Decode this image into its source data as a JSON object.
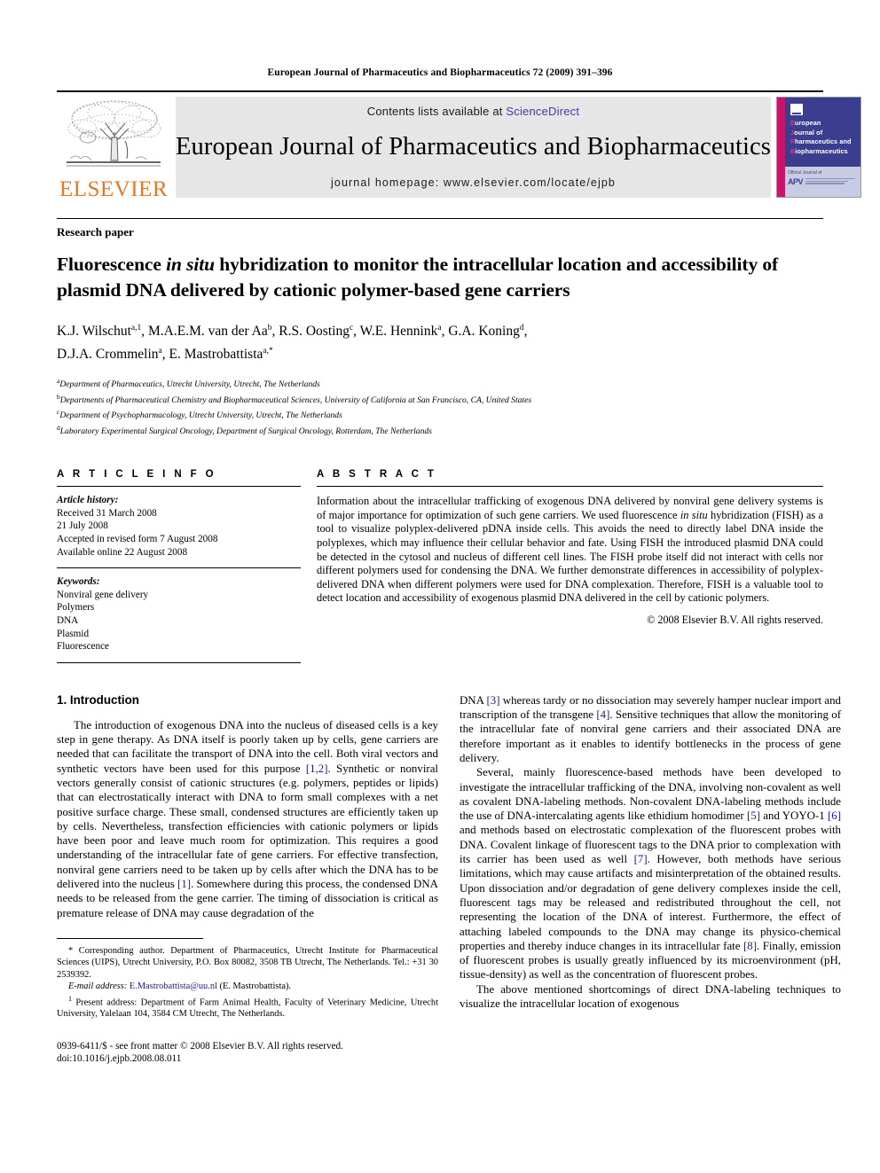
{
  "running_head": "European Journal of Pharmaceutics and Biopharmaceutics 72 (2009) 391–396",
  "masthead": {
    "publisher_name": "ELSEVIER",
    "contents_prefix": "Contents lists available at ",
    "sciencedirect": "ScienceDirect",
    "journal_title": "European Journal of Pharmaceutics and Biopharmaceutics",
    "homepage": "journal homepage: www.elsevier.com/locate/ejpb",
    "sciencedirect_color": "#3b3bb0",
    "elsevier_orange": "#e87722",
    "cover": {
      "line1_cap": "E",
      "line1_rest": "uropean",
      "line2_cap": "J",
      "line2_rest": "ournal of",
      "line3_cap": "P",
      "line3_rest": "harmaceutics and",
      "line4_cap": "B",
      "line4_rest": "iopharmaceutics",
      "footer_label": "Official Journal of",
      "apv": "APV",
      "band_color": "#3b3d8f",
      "spine_color": "#c7156b",
      "body_color": "#c8cbe4"
    }
  },
  "article_type": "Research paper",
  "title": {
    "part1": "Fluorescence ",
    "italic": "in situ",
    "part2": " hybridization to monitor the intracellular location and accessibility of plasmid DNA delivered by cationic polymer-based gene carriers"
  },
  "authors": [
    {
      "name": "K.J. Wilschut",
      "sup": "a,1",
      "sep": ", "
    },
    {
      "name": "M.A.E.M. van der Aa",
      "sup": "b",
      "sep": ", "
    },
    {
      "name": "R.S. Oosting",
      "sup": "c",
      "sep": ", "
    },
    {
      "name": "W.E. Hennink",
      "sup": "a",
      "sep": ", "
    },
    {
      "name": "G.A. Koning",
      "sup": "d",
      "sep": ", "
    },
    {
      "name": "D.J.A. Crommelin",
      "sup": "a",
      "sep": ", "
    },
    {
      "name": "E. Mastrobattista",
      "sup": "a,*",
      "sep": ""
    }
  ],
  "affiliations": [
    {
      "mark": "a",
      "text": "Department of Pharmaceutics, Utrecht University, Utrecht, The Netherlands"
    },
    {
      "mark": "b",
      "text": "Departments of Pharmaceutical Chemistry and Biopharmaceutical Sciences, University of California at San Francisco, CA, United States"
    },
    {
      "mark": "c",
      "text": "Department of Psychopharmacology, Utrecht University, Utrecht, The Netherlands"
    },
    {
      "mark": "d",
      "text": "Laboratory Experimental Surgical Oncology, Department of Surgical Oncology, Rotterdam, The Netherlands"
    }
  ],
  "article_info": {
    "heading": "A R T I C L E    I N F O",
    "history_label": "Article history:",
    "history": [
      "Received 31 March 2008",
      " 21 July 2008",
      "Accepted in revised form 7 August 2008",
      "Available online 22 August 2008"
    ],
    "keywords_label": "Keywords:",
    "keywords": [
      "Nonviral gene delivery",
      "Polymers",
      "DNA",
      "Plasmid",
      "Fluorescence"
    ]
  },
  "abstract": {
    "heading": "A B S T R A C T",
    "p1": "Information about the intracellular trafficking of exogenous DNA delivered by nonviral gene delivery systems is of major importance for optimization of such gene carriers. We used fluorescence ",
    "italic": "in situ",
    "p2": " hybridization (FISH) as a tool to visualize polyplex-delivered pDNA inside cells. This avoids the need to directly label DNA inside the polyplexes, which may influence their cellular behavior and fate. Using FISH the introduced plasmid DNA could be detected in the cytosol and nucleus of different cell lines. The FISH probe itself did not interact with cells nor different polymers used for condensing the DNA. We further demonstrate differences in accessibility of polyplex-delivered DNA when different polymers were used for DNA complexation. Therefore, FISH is a valuable tool to detect location and accessibility of exogenous plasmid DNA delivered in the cell by cationic polymers.",
    "copyright": "© 2008 Elsevier B.V. All rights reserved."
  },
  "body": {
    "section_heading": "1. Introduction",
    "left_p1_a": "The introduction of exogenous DNA into the nucleus of diseased cells is a key step in gene therapy. As DNA itself is poorly taken up by cells, gene carriers are needed that can facilitate the transport of DNA into the cell. Both viral vectors and synthetic vectors have been used for this purpose ",
    "left_p1_ref1": "[1,2]",
    "left_p1_b": ". Synthetic or nonviral vectors generally consist of cationic structures (e.g. polymers, peptides or lipids) that can electrostatically interact with DNA to form small complexes with a net positive surface charge. These small, condensed structures are efficiently taken up by cells. Nevertheless, transfection efficiencies with cationic polymers or lipids have been poor and leave much room for optimization. This requires a good understanding of the intracellular fate of gene carriers. For effective transfection, nonviral gene carriers need to be taken up by cells after which the DNA has to be delivered into the nucleus ",
    "left_p1_ref2": "[1]",
    "left_p1_c": ". Somewhere during this process, the condensed DNA needs to be released from the gene carrier. The timing of dissociation is critical as premature release of DNA may cause degradation of the",
    "right_p1_a": "DNA ",
    "right_p1_ref1": "[3]",
    "right_p1_b": " whereas tardy or no dissociation may severely hamper nuclear import and transcription of the transgene ",
    "right_p1_ref2": "[4]",
    "right_p1_c": ". Sensitive techniques that allow the monitoring of the intracellular fate of nonviral gene carriers and their associated DNA are therefore important as it enables to identify bottlenecks in the process of gene delivery.",
    "right_p2_a": "Several, mainly fluorescence-based methods have been developed to investigate the intracellular trafficking of the DNA, involving non-covalent as well as covalent DNA-labeling methods. Non-covalent DNA-labeling methods include the use of DNA-intercalating agents like ethidium homodimer ",
    "right_p2_ref1": "[5]",
    "right_p2_b": " and YOYO-1 ",
    "right_p2_ref2": "[6]",
    "right_p2_c": " and methods based on electrostatic complexation of the fluorescent probes with DNA. Covalent linkage of fluorescent tags to the DNA prior to complexation with its carrier has been used as well ",
    "right_p2_ref3": "[7]",
    "right_p2_d": ". However, both methods have serious limitations, which may cause artifacts and misinterpretation of the obtained results. Upon dissociation and/or degradation of gene delivery complexes inside the cell, fluorescent tags may be released and redistributed throughout the cell, not representing the location of the DNA of interest. Furthermore, the effect of attaching labeled compounds to the DNA may change its physico-chemical properties and thereby induce changes in its intracellular fate ",
    "right_p2_ref4": "[8]",
    "right_p2_e": ". Finally, emission of fluorescent probes is usually greatly influenced by its microenvironment (pH, tissue-density) as well as the concentration of fluorescent probes.",
    "right_p3": "The above mentioned shortcomings of direct DNA-labeling techniques to visualize the intracellular location of exogenous"
  },
  "footnotes": {
    "corresponding": "* Corresponding author. Department of Pharmaceutics, Utrecht Institute for Pharmaceutical Sciences (UIPS), Utrecht University, P.O. Box 80082, 3508 TB Utrecht, The Netherlands. Tel.: +31 30 2539392.",
    "email_label": "E-mail address:",
    "email": "E.Mastrobattista@uu.nl",
    "email_suffix": " (E. Mastrobattista).",
    "present_address_mark": "1",
    "present_address": " Present address: Department of Farm Animal Health, Faculty of Veterinary Medicine, Utrecht University, Yalelaan 104, 3584 CM Utrecht, The Netherlands."
  },
  "imprint": {
    "line1": "0939-6411/$ - see front matter © 2008 Elsevier B.V. All rights reserved.",
    "line2": "doi:10.1016/j.ejpb.2008.08.011"
  }
}
